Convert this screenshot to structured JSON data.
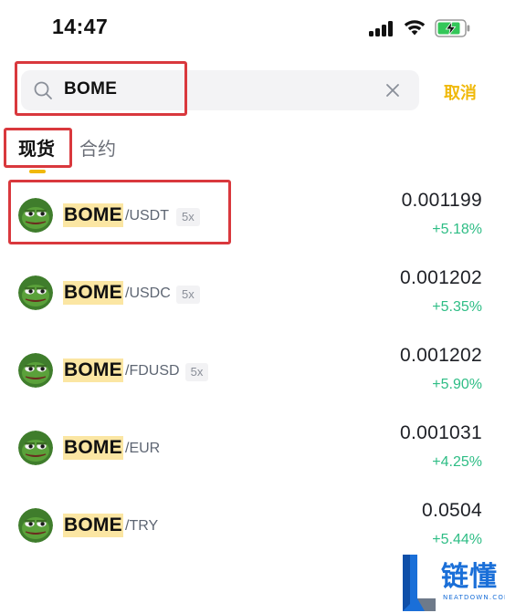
{
  "status_bar": {
    "time": "14:47"
  },
  "search": {
    "query": "BOME",
    "cancel_label": "取消"
  },
  "tabs": [
    {
      "label": "现货",
      "active": true
    },
    {
      "label": "合约",
      "active": false
    }
  ],
  "results": [
    {
      "base": "BOME",
      "quote": "/USDT",
      "leverage": "5x",
      "price": "0.001199",
      "change": "+5.18%"
    },
    {
      "base": "BOME",
      "quote": "/USDC",
      "leverage": "5x",
      "price": "0.001202",
      "change": "+5.35%"
    },
    {
      "base": "BOME",
      "quote": "/FDUSD",
      "leverage": "5x",
      "price": "0.001202",
      "change": "+5.90%"
    },
    {
      "base": "BOME",
      "quote": "/EUR",
      "leverage": "",
      "price": "0.001031",
      "change": "+4.25%"
    },
    {
      "base": "BOME",
      "quote": "/TRY",
      "leverage": "",
      "price": "0.0504",
      "change": "+5.44%"
    }
  ],
  "watermark": {
    "name": "链懂",
    "sub": "NEATDOWN.COM"
  },
  "colors": {
    "accent": "#f0b90b",
    "positive": "#2ebd85",
    "highlight": "#fbe6a3",
    "callout": "#d9383d"
  },
  "icons": {
    "search": "search-icon",
    "clear": "close-icon",
    "avatar": "pepe-avatar-icon"
  }
}
